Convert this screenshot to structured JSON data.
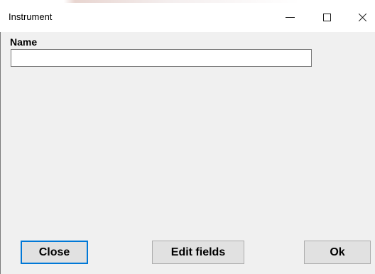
{
  "window": {
    "title": "Instrument",
    "controls": {
      "minimize_icon": "minimize-icon",
      "maximize_icon": "maximize-icon",
      "close_icon": "close-icon"
    }
  },
  "form": {
    "name_label": "Name",
    "name_value": "",
    "name_placeholder": ""
  },
  "buttons": {
    "close_label": "Close",
    "edit_fields_label": "Edit fields",
    "ok_label": "Ok"
  },
  "colors": {
    "window_background": "#f0f0f0",
    "titlebar_background": "#ffffff",
    "focus_border": "#0078d7",
    "button_background": "#e1e1e1"
  }
}
